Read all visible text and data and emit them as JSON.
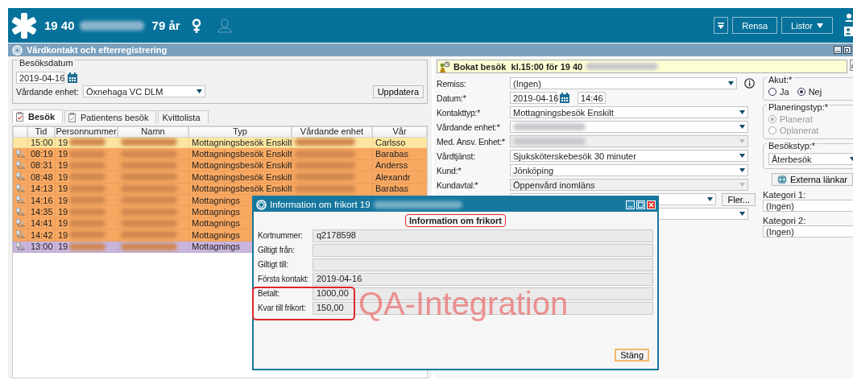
{
  "header": {
    "patient_id": "19 40",
    "age": "79 år",
    "buttons": [
      {
        "label": "Rensa",
        "kind": "plain"
      },
      {
        "label": "Listor",
        "kind": "dropdown"
      }
    ]
  },
  "window": {
    "title": "Vårdkontakt och efterregistrering"
  },
  "date_group": {
    "legend": "Besöksdatum",
    "date": "2019-04-16",
    "unit_label": "Vårdande enhet:",
    "unit_value": "Öxnehaga VC DLM",
    "update_button": "Uppdatera"
  },
  "tabs": [
    {
      "label": "Besök",
      "selected": true
    },
    {
      "label": "Patientens besök",
      "selected": false
    },
    {
      "label": "Kvittolista",
      "selected": false
    }
  ],
  "table": {
    "columns": [
      "Tid",
      "Personnummer",
      "Namn",
      "Typ",
      "Vårdande enhet",
      "Vår"
    ],
    "rows": [
      {
        "time": "15:00",
        "personnummer": "19",
        "type": "Mottagningsbesök Enskilt",
        "column_6": "Carlsso",
        "color": "#fde7a0",
        "kind": "booked"
      },
      {
        "time": "08:19",
        "personnummer": "19",
        "type": "Mottagningsbesök Enskilt",
        "column_6": "Barabas",
        "color": "#f9a861",
        "kind": "registered"
      },
      {
        "time": "08:31",
        "personnummer": "19",
        "type": "Mottagningsbesök Enskilt",
        "column_6": "Anderss",
        "color": "#f9a861",
        "kind": "registered"
      },
      {
        "time": "08:48",
        "personnummer": "19",
        "type": "Mottagningsbesök Enskilt",
        "column_6": "Alexandr",
        "color": "#f9a861",
        "kind": "registered"
      },
      {
        "time": "14:13",
        "personnummer": "19",
        "type": "Mottagningsbesök Enskilt",
        "column_6": "Barabas",
        "color": "#f9a861",
        "kind": "registered"
      },
      {
        "time": "14:16",
        "personnummer": "19",
        "type": "Mottagnings",
        "color": "#f9a861",
        "kind": "registered"
      },
      {
        "time": "14:35",
        "personnummer": "19",
        "type": "Mottagnings",
        "color": "#f9a861",
        "kind": "registered"
      },
      {
        "time": "14:41",
        "personnummer": "19",
        "type": "Mottagnings",
        "color": "#f9a861",
        "kind": "registered"
      },
      {
        "time": "14:42",
        "personnummer": "19",
        "type": "Mottagnings",
        "color": "#f9a861",
        "kind": "registered"
      },
      {
        "time": "13:00",
        "personnummer": "19",
        "type": "Mottagnings",
        "color": "#c9b5dc",
        "kind": "registered"
      }
    ]
  },
  "banner": "Bokat besök  kl.15:00 för 19 40",
  "form": [
    {
      "label": "Remiss:",
      "value": "(Ingen)",
      "kind": "select-info"
    },
    {
      "label": "Datum:*",
      "value": "2019-04-16",
      "time": "14:46",
      "kind": "date"
    },
    {
      "label": "Kontakttyp:*",
      "value": "Mottagningsbesök Enskilt",
      "kind": "select"
    },
    {
      "label": "Vårdande enhet:*",
      "kind": "blurred"
    },
    {
      "label": "Med. Ansv. Enhet:*",
      "kind": "blurred-disabled"
    },
    {
      "label": "Vårdtjänst:",
      "value": "Sjuksköterskebesök 30 minuter",
      "kind": "select"
    },
    {
      "label": "Kund:*",
      "value": "Jönköping",
      "kind": "select"
    },
    {
      "label": "Kundavtal:*",
      "value": "Öppenvård inomläns",
      "kind": "disabled"
    },
    {
      "button": "Fler...",
      "kind": "select-button"
    },
    {
      "kind": "select"
    }
  ],
  "side": {
    "akut": {
      "legend": "Akut:*",
      "options": [
        {
          "label": "Ja",
          "selected": false
        },
        {
          "label": "Nej",
          "selected": true
        }
      ]
    },
    "planering": {
      "legend": "Planeringstyp:*",
      "options": [
        {
          "label": "Planerat",
          "selected": true
        },
        {
          "label": "Oplanerat",
          "selected": false
        }
      ]
    },
    "besokstyp": {
      "legend": "Besökstyp:*",
      "value": "Återbesök"
    },
    "links_button": "Externa länkar",
    "categories": [
      {
        "label": "Kategori 1:",
        "value": "(Ingen)"
      },
      {
        "label": "Kategori 2:",
        "value": "(Ingen)"
      }
    ]
  },
  "dialog": {
    "title": "Information om frikort 19",
    "heading": "Information om frikort",
    "fields": [
      {
        "label": "Kortnummer:",
        "value": "q2178598"
      },
      {
        "label": "Giltigt från:"
      },
      {
        "label": "Giltigt till:"
      },
      {
        "label": "Första kontakt:",
        "value": "2019-04-16"
      },
      {
        "label": "Betalt:",
        "value": "1000,00"
      },
      {
        "label": "Kvar till frikort:",
        "value": "150,00"
      }
    ],
    "close_button": "Stäng",
    "environment_label": "QA-Integration"
  }
}
